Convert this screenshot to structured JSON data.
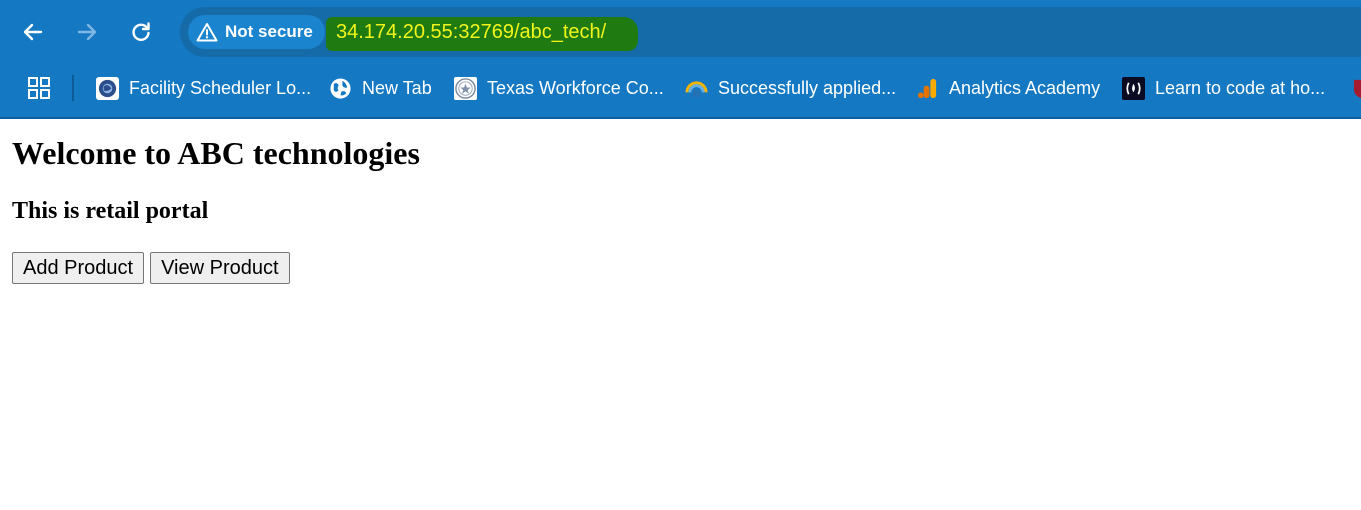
{
  "browser": {
    "security_label": "Not secure",
    "url": "34.174.20.55:32769/abc_tech/",
    "bookmarks": [
      {
        "label": "Facility Scheduler Lo...",
        "icon": "globe-seal-icon"
      },
      {
        "label": "New Tab",
        "icon": "globe-icon"
      },
      {
        "label": "Texas Workforce Co...",
        "icon": "seal-icon"
      },
      {
        "label": "Successfully applied...",
        "icon": "rainbow-icon"
      },
      {
        "label": "Analytics Academy",
        "icon": "analytics-icon"
      },
      {
        "label": "Learn to code at ho...",
        "icon": "freecodecamp-icon"
      }
    ],
    "colors": {
      "chrome": "#1478c2",
      "omnibox": "#156aa8",
      "url_highlight": "#1f7a12",
      "url_text": "#f2f51a"
    }
  },
  "page": {
    "heading": "Welcome to ABC technologies",
    "subheading": "This is retail portal",
    "buttons": {
      "add": "Add Product",
      "view": "View Product"
    }
  }
}
